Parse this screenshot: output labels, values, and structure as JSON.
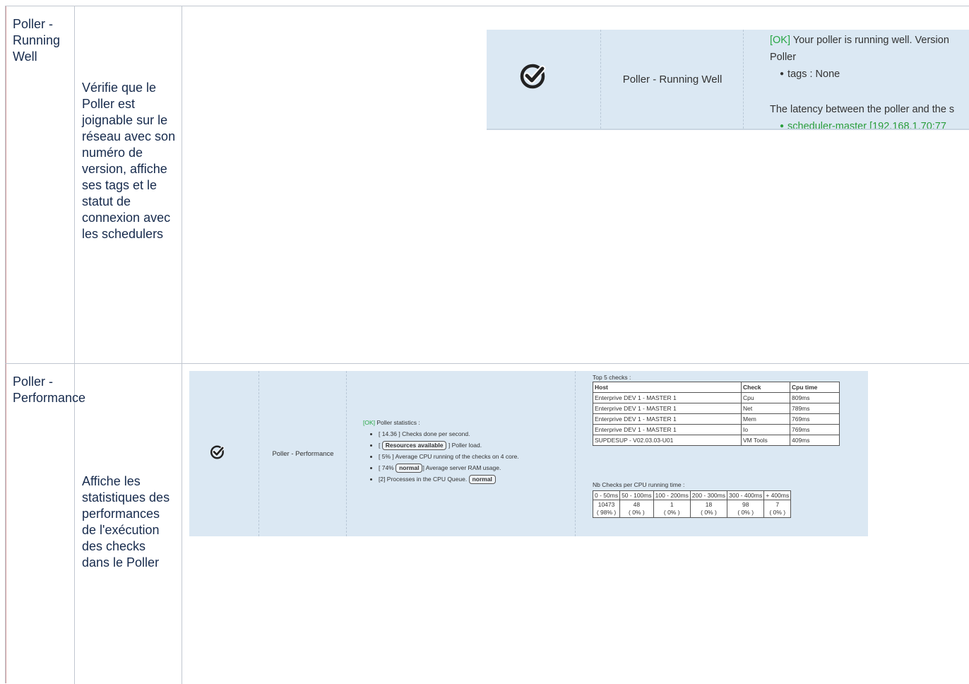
{
  "rows": [
    {
      "name": "Poller - Running Well",
      "description": "Vérifie que le Poller est joignable sur le réseau avec son numéro de version, affiche ses tags et le statut de connexion avec les schedulers",
      "screenshot": {
        "name": "Poller - Running Well",
        "ok_tag": "[OK]",
        "line1": " Your poller is running well. Version",
        "line2": "Poller",
        "tags": "tags : None",
        "latency": "The latency between the poller and the s",
        "scheduler": "scheduler-master [192.168.1.70:77"
      }
    },
    {
      "name": "Poller - Performance",
      "description": "Affiche les statistiques des performances de l'exécution des checks dans le Poller",
      "screenshot": {
        "name": "Poller - Performance",
        "ok_tag": "[OK]",
        "stats_title": " Poller statistics :",
        "stat1": "[ 14.36 ] Checks done per second.",
        "stat2_pre": "[ ",
        "stat2_badge": "Resources available",
        "stat2_post": " ] Poller load.",
        "stat3": "[ 5% ] Average CPU running of the checks on 4 core.",
        "stat4_pre": "[ 74% ",
        "stat4_badge": "normal",
        "stat4_post": "] Average server RAM usage.",
        "stat5_pre": "[2] Processes in the CPU Queue. ",
        "stat5_badge": "normal",
        "top5_label": "Top 5 checks :",
        "top5_headers": [
          "Host",
          "Check",
          "Cpu time"
        ],
        "top5_rows": [
          [
            "Enterprive DEV 1 - MASTER 1",
            "Cpu",
            "809ms"
          ],
          [
            "Enterprive DEV 1 - MASTER 1",
            "Net",
            "789ms"
          ],
          [
            "Enterprive DEV 1 - MASTER 1",
            "Mem",
            "769ms"
          ],
          [
            "Enterprive DEV 1 - MASTER 1",
            "Io",
            "769ms"
          ],
          [
            "SUPDESUP - V02.03.03-U01",
            "VM Tools",
            "409ms"
          ]
        ],
        "nb_label": "Nb Checks per CPU running time :",
        "nb_headers": [
          "0 - 50ms",
          "50 - 100ms",
          "100 - 200ms",
          "200 - 300ms",
          "300 - 400ms",
          "+ 400ms"
        ],
        "nb_counts": [
          "10473",
          "48",
          "1",
          "18",
          "98",
          "7"
        ],
        "nb_pcts": [
          "( 98% )",
          "( 0% )",
          "( 0% )",
          "( 0% )",
          "( 0% )",
          "( 0% )"
        ]
      }
    }
  ],
  "colors": {
    "ok": "#27a744",
    "panel_bg": "#dbe8f3",
    "border": "#c1c7d0"
  },
  "icons": [
    "check-circle-icon"
  ]
}
